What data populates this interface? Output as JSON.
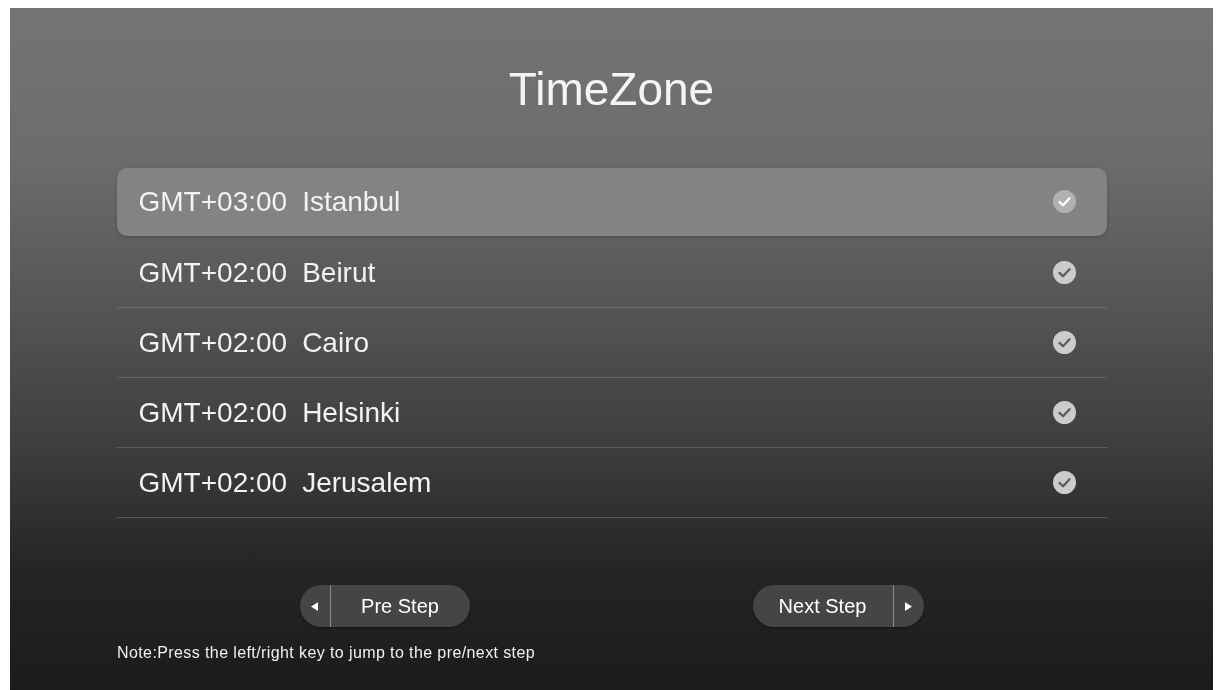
{
  "title": "TimeZone",
  "timezones": [
    {
      "offset": "GMT+03:00",
      "city": "Istanbul",
      "selected": true
    },
    {
      "offset": "GMT+02:00",
      "city": "Beirut",
      "selected": false
    },
    {
      "offset": "GMT+02:00",
      "city": "Cairo",
      "selected": false
    },
    {
      "offset": "GMT+02:00",
      "city": "Helsinki",
      "selected": false
    },
    {
      "offset": "GMT+02:00",
      "city": "Jerusalem",
      "selected": false
    }
  ],
  "buttons": [
    {
      "kind": "previous",
      "label": "Pre Step"
    },
    {
      "kind": "next",
      "label": "Next Step"
    }
  ],
  "note": "Note:Press the left/right key to jump to the pre/next step"
}
